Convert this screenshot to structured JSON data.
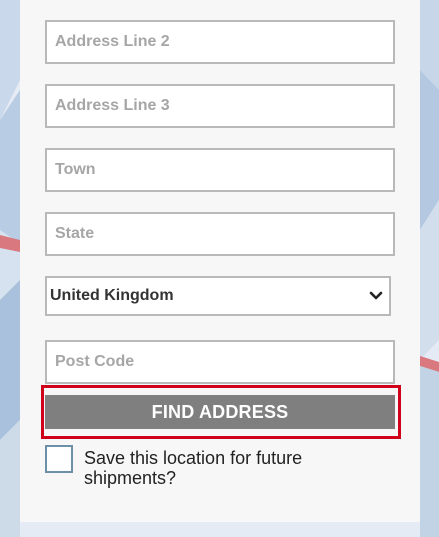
{
  "form": {
    "address_line_2": {
      "value": "",
      "placeholder": "Address Line 2"
    },
    "address_line_3": {
      "value": "",
      "placeholder": "Address Line 3"
    },
    "town": {
      "value": "",
      "placeholder": "Town"
    },
    "state": {
      "value": "",
      "placeholder": "State"
    },
    "country": {
      "selected": "United Kingdom",
      "icon": "chevron-down-icon"
    },
    "post_code": {
      "value": "",
      "placeholder": "Post Code"
    },
    "find_address_label": "FIND ADDRESS",
    "save_location": {
      "checked": false,
      "label": "Save this location for future shipments?"
    }
  },
  "colors": {
    "panel": "#f7f7f7",
    "field_border": "#b9b9b9",
    "button": "#7f7f7f",
    "highlight": "#d0021b",
    "checkbox_border": "#6d90a8"
  }
}
